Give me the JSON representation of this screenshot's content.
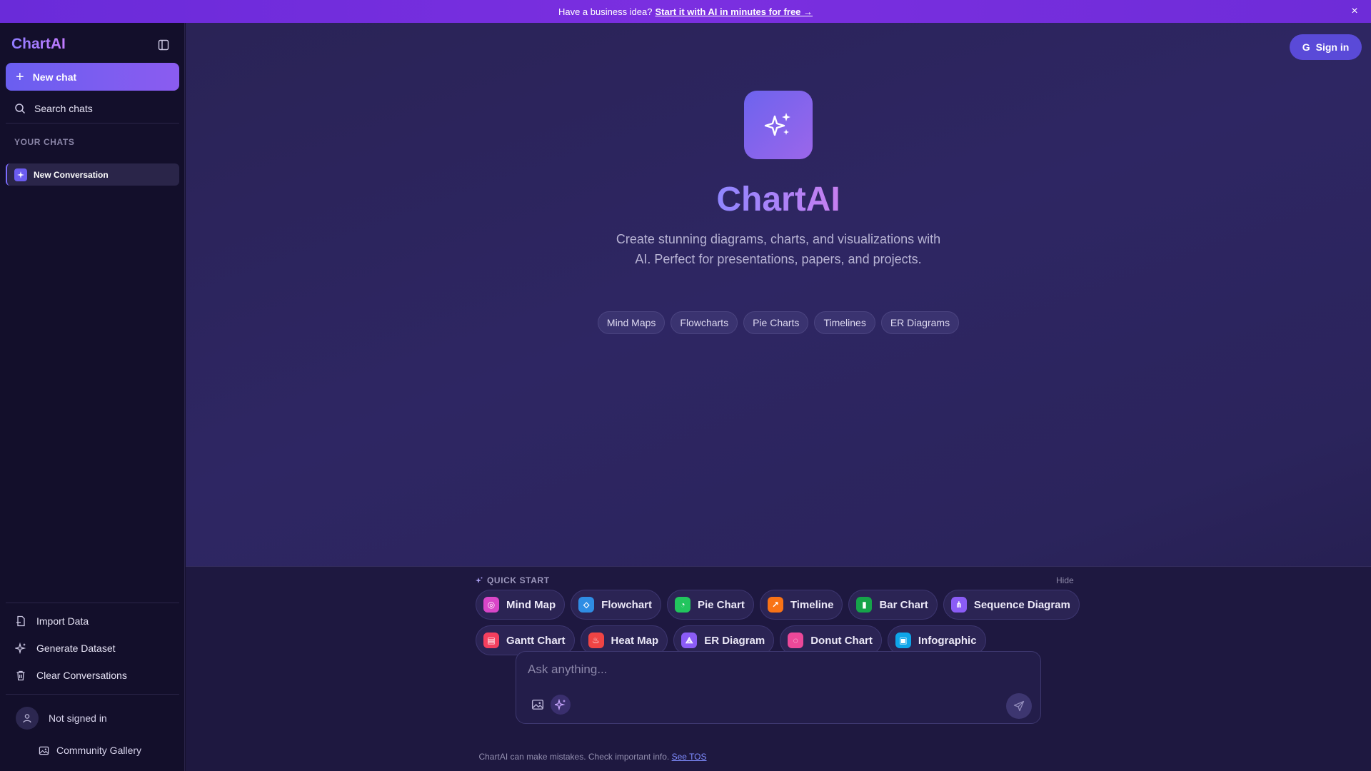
{
  "banner": {
    "text": "Have a business idea?",
    "cta": "Start it with AI in minutes for free →",
    "close": "×"
  },
  "sidebar": {
    "brand": "ChartAI",
    "new_chat": "New chat",
    "search": "Search chats",
    "section": "YOUR CHATS",
    "chats": [
      {
        "label": "New Conversation"
      }
    ],
    "actions": {
      "import": "Import Data",
      "generate": "Generate Dataset",
      "clear": "Clear Conversations"
    },
    "user": "Not signed in",
    "gallery": "Community Gallery"
  },
  "header": {
    "signin": "Sign in",
    "signin_icon": "G"
  },
  "hero": {
    "title": "ChartAI",
    "subtitle": "Create stunning diagrams, charts, and visualizations with AI. Perfect for presentations, papers, and projects.",
    "tags": [
      "Mind Maps",
      "Flowcharts",
      "Pie Charts",
      "Timelines",
      "ER Diagrams"
    ]
  },
  "quick_start": {
    "label": "QUICK START",
    "hide": "Hide",
    "row1": [
      {
        "label": "Mind Map",
        "color": "#d946c8",
        "icon": "mind-map-icon"
      },
      {
        "label": "Flowchart",
        "color": "#2f8de4",
        "icon": "flowchart-icon"
      },
      {
        "label": "Pie Chart",
        "color": "#22c55e",
        "icon": "pie-chart-icon"
      },
      {
        "label": "Timeline",
        "color": "#f97316",
        "icon": "timeline-icon"
      },
      {
        "label": "Bar Chart",
        "color": "#16a34a",
        "icon": "bar-chart-icon"
      },
      {
        "label": "Sequence Diagram",
        "color": "#8b5cf6",
        "icon": "sequence-icon"
      }
    ],
    "row2": [
      {
        "label": "Gantt Chart",
        "color": "#f43f5e",
        "icon": "gantt-icon"
      },
      {
        "label": "Heat Map",
        "color": "#ef4444",
        "icon": "heat-map-icon"
      },
      {
        "label": "ER Diagram",
        "color": "#8b5cf6",
        "icon": "er-diagram-icon"
      },
      {
        "label": "Donut Chart",
        "color": "#ec4899",
        "icon": "donut-chart-icon"
      },
      {
        "label": "Infographic",
        "color": "#0ea5e9",
        "icon": "infographic-icon"
      }
    ]
  },
  "composer": {
    "placeholder": "Ask anything...",
    "value": ""
  },
  "footer": {
    "disclaimer": "ChartAI can make mistakes. Check important info.",
    "tos": "See TOS"
  }
}
